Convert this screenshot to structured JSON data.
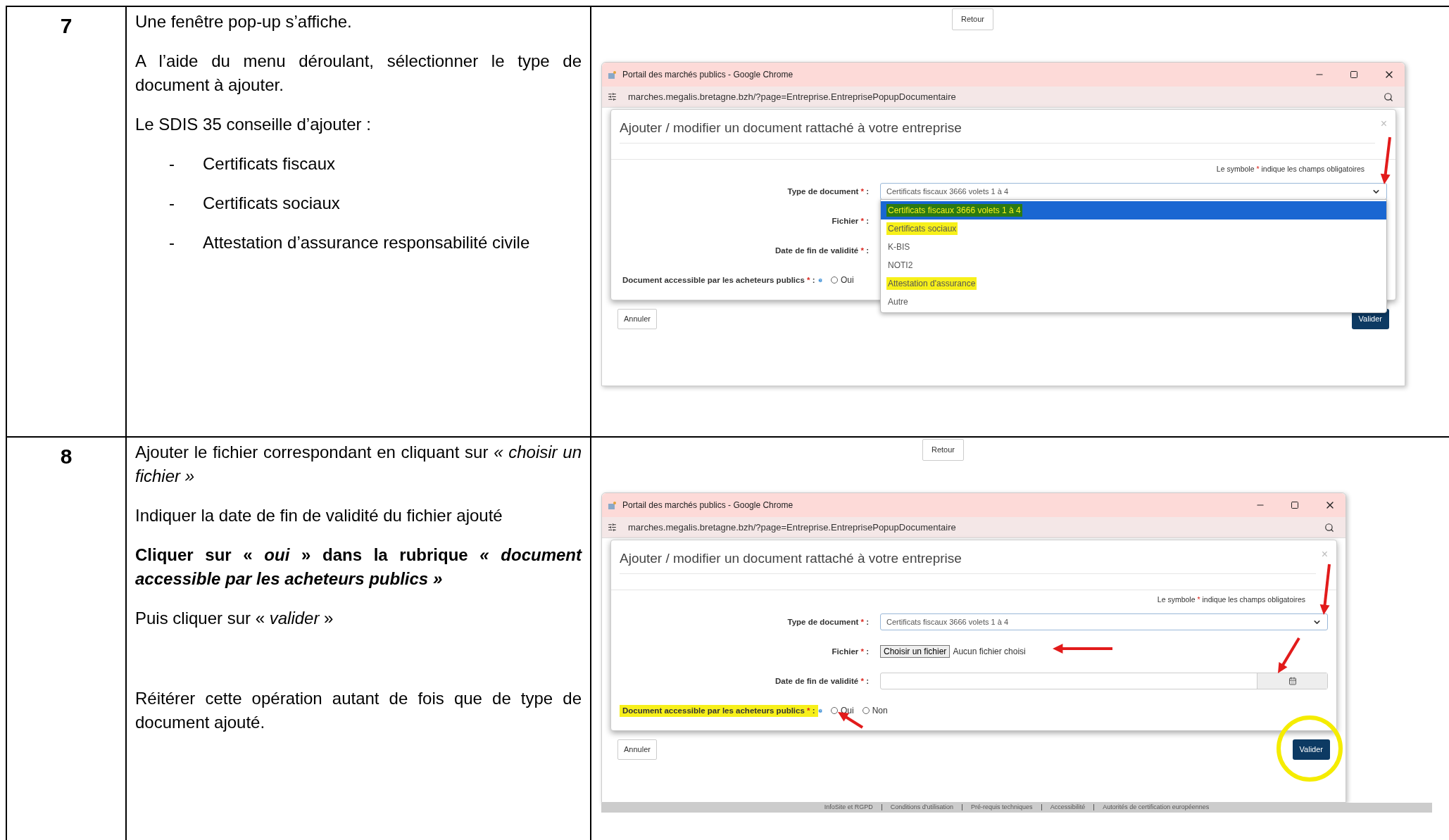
{
  "steps": [
    {
      "number": "7",
      "paragraphs": [
        {
          "text": "Une fenêtre pop-up s’affiche.",
          "bold": false
        },
        {
          "text": "A l’aide du menu déroulant, sélectionner le type de document à ajouter.",
          "bold": false
        },
        {
          "text": "Le SDIS 35 conseille d’ajouter :",
          "bold": false
        }
      ],
      "bullets": [
        {
          "dash": "-",
          "text": "Certificats fiscaux"
        },
        {
          "dash": "-",
          "text": "Certificats sociaux"
        },
        {
          "dash": "-",
          "text": "Attestation d’assurance responsabilité civile"
        }
      ],
      "screenshot": {
        "back_button": "Retour",
        "browser": {
          "title": "Portail des marchés publics - Google Chrome",
          "url": "marches.megalis.bretagne.bzh/?page=Entreprise.EntreprisePopupDocumentaire"
        },
        "dialog": {
          "title": "Ajouter / modifier un document rattaché à votre entreprise",
          "close": "×",
          "required_note": {
            "before": "Le symbole",
            "mark": "*",
            "after": "indique les champs obligatoires"
          },
          "fields": [
            {
              "kind": "select",
              "label": "Type de document",
              "mark": "*",
              "colon": ":",
              "highlighted": false,
              "value": "Certificats fiscaux 3666 volets 1 à 4"
            },
            {
              "kind": "file",
              "label": "Fichier",
              "mark": "*",
              "colon": ":",
              "highlighted": false
            },
            {
              "kind": "date",
              "label": "Date de fin de validité",
              "mark": "*",
              "colon": ":",
              "highlighted": false,
              "calendar": false
            },
            {
              "kind": "radio",
              "label": "Document accessible par les acheteurs publics",
              "mark": "*",
              "colon": ":",
              "highlighted": false,
              "options": [
                {
                  "label": "Oui",
                  "selected": false
                }
              ]
            }
          ],
          "dropdown": [
            {
              "label": "Certificats fiscaux 3666 volets 1 à 4",
              "selected": true,
              "highlighted": true
            },
            {
              "label": "Certificats sociaux",
              "selected": false,
              "highlighted": true
            },
            {
              "label": "K-BIS",
              "selected": false,
              "highlighted": false
            },
            {
              "label": "NOTI2",
              "selected": false,
              "highlighted": false
            },
            {
              "label": "Attestation d'assurance",
              "selected": false,
              "highlighted": true
            },
            {
              "label": "Autre",
              "selected": false,
              "highlighted": false
            }
          ]
        },
        "cancel": "Annuler",
        "submit": "Valider"
      }
    },
    {
      "number": "8",
      "paragraphs": [
        {
          "text": "Ajouter le fichier correspondant en cliquant sur *« choisir un fichier »*",
          "bold": false
        },
        {
          "text": "Indiquer la date de fin de validité du fichier ajouté",
          "bold": false
        },
        {
          "text": "Cliquer sur « *oui* » dans la rubrique *« document accessible par les acheteurs publics »*",
          "bold": true
        },
        {
          "text": "Puis cliquer sur « *valider* »",
          "bold": false
        },
        {
          "text": "Réitérer cette opération autant de fois que de type de document ajouté.",
          "bold": false
        }
      ],
      "screenshot": {
        "back_button": "Retour",
        "browser": {
          "title": "Portail des marchés publics - Google Chrome",
          "url": "marches.megalis.bretagne.bzh/?page=Entreprise.EntreprisePopupDocumentaire"
        },
        "dialog": {
          "title": "Ajouter / modifier un document rattaché à votre entreprise",
          "close": "×",
          "required_note": {
            "before": "Le symbole",
            "mark": "*",
            "after": "indique les champs obligatoires"
          },
          "fields": [
            {
              "kind": "select",
              "label": "Type de document",
              "mark": "*",
              "colon": ":",
              "highlighted": false,
              "value": "Certificats fiscaux 3666 volets 1 à 4"
            },
            {
              "kind": "file",
              "label": "Fichier",
              "mark": "*",
              "colon": ":",
              "highlighted": false,
              "button": "Choisir un fichier",
              "status": "Aucun fichier choisi"
            },
            {
              "kind": "date",
              "label": "Date de fin de validité",
              "mark": "*",
              "colon": ":",
              "highlighted": false,
              "calendar": true
            },
            {
              "kind": "radio",
              "label": "Document accessible par les acheteurs publics",
              "mark": "*",
              "colon": ":",
              "highlighted": true,
              "options": [
                {
                  "label": "Oui",
                  "selected": false
                },
                {
                  "label": "Non",
                  "selected": false
                }
              ]
            }
          ]
        },
        "cancel": "Annuler",
        "submit": "Valider",
        "footer_links": [
          "InfoSite et RGPD",
          "Conditions d'utilisation",
          "Pré-requis techniques",
          "Accessibilité",
          "Autorités de certification européennes"
        ]
      }
    }
  ]
}
